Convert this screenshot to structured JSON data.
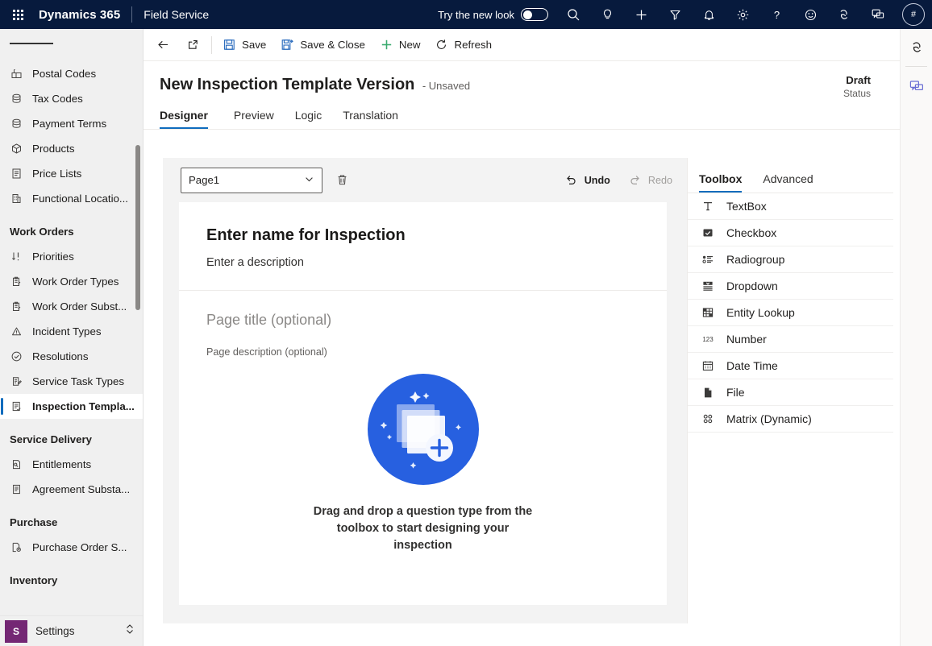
{
  "appbar": {
    "waffle_label": "app-launcher",
    "brand": "Dynamics 365",
    "app_name": "Field Service",
    "new_look_label": "Try the new look",
    "new_look_on": false,
    "icons": [
      "search-icon",
      "lightbulb-icon",
      "plus-icon",
      "filter-icon",
      "bell-icon",
      "gear-icon",
      "help-icon",
      "smiley-icon",
      "copilot-icon",
      "chat-icon"
    ],
    "avatar_initials": "#",
    "background": "#071A3D"
  },
  "sidebar": {
    "items": [
      {
        "label": "Postal Codes",
        "icon": "postal-icon",
        "selected": false
      },
      {
        "label": "Tax Codes",
        "icon": "stack-icon",
        "selected": false
      },
      {
        "label": "Payment Terms",
        "icon": "stack-icon",
        "selected": false
      },
      {
        "label": "Products",
        "icon": "box-icon",
        "selected": false
      },
      {
        "label": "Price Lists",
        "icon": "list-doc-icon",
        "selected": false
      },
      {
        "label": "Functional Locatio...",
        "icon": "building-icon",
        "selected": false
      }
    ],
    "groups": [
      {
        "title": "Work Orders",
        "items": [
          {
            "label": "Priorities",
            "icon": "sort-icon",
            "selected": false
          },
          {
            "label": "Work Order Types",
            "icon": "clipboard-icon",
            "selected": false
          },
          {
            "label": "Work Order Subst...",
            "icon": "clipboard-icon",
            "selected": false
          },
          {
            "label": "Incident Types",
            "icon": "warning-icon",
            "selected": false
          },
          {
            "label": "Resolutions",
            "icon": "check-circle-icon",
            "selected": false
          },
          {
            "label": "Service Task Types",
            "icon": "task-icon",
            "selected": false
          },
          {
            "label": "Inspection Templa...",
            "icon": "inspection-icon",
            "selected": true
          }
        ]
      },
      {
        "title": "Service Delivery",
        "items": [
          {
            "label": "Entitlements",
            "icon": "entitlement-icon",
            "selected": false
          },
          {
            "label": "Agreement Substa...",
            "icon": "agreement-icon",
            "selected": false
          }
        ]
      },
      {
        "title": "Purchase",
        "items": [
          {
            "label": "Purchase Order S...",
            "icon": "purchase-icon",
            "selected": false
          }
        ]
      },
      {
        "title": "Inventory",
        "items": []
      }
    ],
    "footer": {
      "badge": "S",
      "label": "Settings",
      "accent": "#742774"
    }
  },
  "commandbar": {
    "back_label": "back",
    "popout_label": "open-in-new-window",
    "items": [
      {
        "label": "Save",
        "icon": "save-icon"
      },
      {
        "label": "Save & Close",
        "icon": "save-close-icon"
      },
      {
        "label": "New",
        "icon": "plus-icon"
      },
      {
        "label": "Refresh",
        "icon": "refresh-icon"
      }
    ]
  },
  "record": {
    "title": "New Inspection Template Version",
    "subtitle": "- Unsaved",
    "status_value": "Draft",
    "status_label": "Status"
  },
  "tabs": [
    {
      "label": "Designer",
      "active": true
    },
    {
      "label": "Preview",
      "active": false
    },
    {
      "label": "Logic",
      "active": false
    },
    {
      "label": "Translation",
      "active": false
    }
  ],
  "designer": {
    "page_select_value": "Page1",
    "delete_page_label": "delete-page",
    "undo_label": "Undo",
    "redo_label": "Redo",
    "undo_enabled": true,
    "redo_enabled": false,
    "inspection_name_placeholder": "Enter name for Inspection",
    "inspection_description_placeholder": "Enter a description",
    "page_title_placeholder": "Page title (optional)",
    "page_description_placeholder": "Page description (optional)",
    "empty_state_text": "Drag and drop a question type from the toolbox to start designing your inspection",
    "empty_state_art": "add-cards-illustration",
    "accent": "#0f6cbd",
    "illustration_color": "#2760e0"
  },
  "toolbox": {
    "tabs": [
      {
        "label": "Toolbox",
        "active": true
      },
      {
        "label": "Advanced",
        "active": false
      }
    ],
    "items": [
      {
        "label": "TextBox",
        "icon": "textbox-icon"
      },
      {
        "label": "Checkbox",
        "icon": "checkbox-icon"
      },
      {
        "label": "Radiogroup",
        "icon": "radiogroup-icon"
      },
      {
        "label": "Dropdown",
        "icon": "dropdown-icon"
      },
      {
        "label": "Entity Lookup",
        "icon": "entity-lookup-icon"
      },
      {
        "label": "Number",
        "icon": "number-icon"
      },
      {
        "label": "Date Time",
        "icon": "calendar-icon"
      },
      {
        "label": "File",
        "icon": "file-icon"
      },
      {
        "label": "Matrix (Dynamic)",
        "icon": "matrix-icon"
      }
    ]
  },
  "rail": {
    "buttons": [
      "copilot-icon",
      "chat-icon"
    ]
  }
}
